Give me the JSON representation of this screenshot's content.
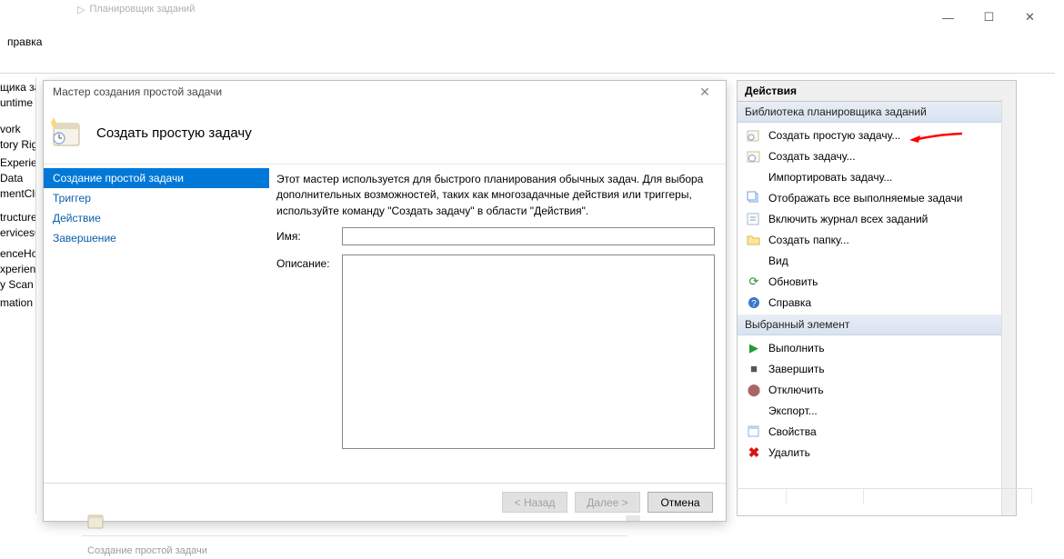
{
  "window_controls": {
    "min": "—",
    "max": "☐",
    "close": "✕"
  },
  "top_tab": "Планировщик заданий",
  "menu": {
    "help": "правка"
  },
  "left_items": [
    "щика за",
    "untime",
    "",
    "",
    "",
    "",
    "vork",
    "tory Righ",
    "",
    "Experienc",
    "Data",
    "mentCli",
    "",
    "",
    "",
    "tructure\\",
    "ervicesCl",
    "",
    "",
    "enceHos",
    "xperienc",
    "y Scan",
    "",
    "mation"
  ],
  "wizard": {
    "title": "Мастер создания простой задачи",
    "heading": "Создать простую задачу",
    "nav": [
      "Создание простой задачи",
      "Триггер",
      "Действие",
      "Завершение"
    ],
    "desc": "Этот мастер используется для быстрого планирования обычных задач.  Для выбора дополнительных возможностей, таких как многозадачные действия или триггеры, используйте команду \"Создать задачу\" в области \"Действия\".",
    "name_label": "Имя:",
    "desc_label": "Описание:",
    "back": "< Назад",
    "next": "Далее >",
    "cancel": "Отмена"
  },
  "bottom_text": "Создание простой задачи",
  "actions": {
    "title": "Действия",
    "group1": {
      "header": "Библиотека планировщика заданий",
      "items": [
        "Создать простую задачу...",
        "Создать задачу...",
        "Импортировать задачу...",
        "Отображать все выполняемые задачи",
        "Включить журнал всех заданий",
        "Создать папку...",
        "Вид",
        "Обновить",
        "Справка"
      ]
    },
    "group2": {
      "header": "Выбранный элемент",
      "items": [
        "Выполнить",
        "Завершить",
        "Отключить",
        "Экспорт...",
        "Свойства",
        "Удалить"
      ]
    }
  }
}
